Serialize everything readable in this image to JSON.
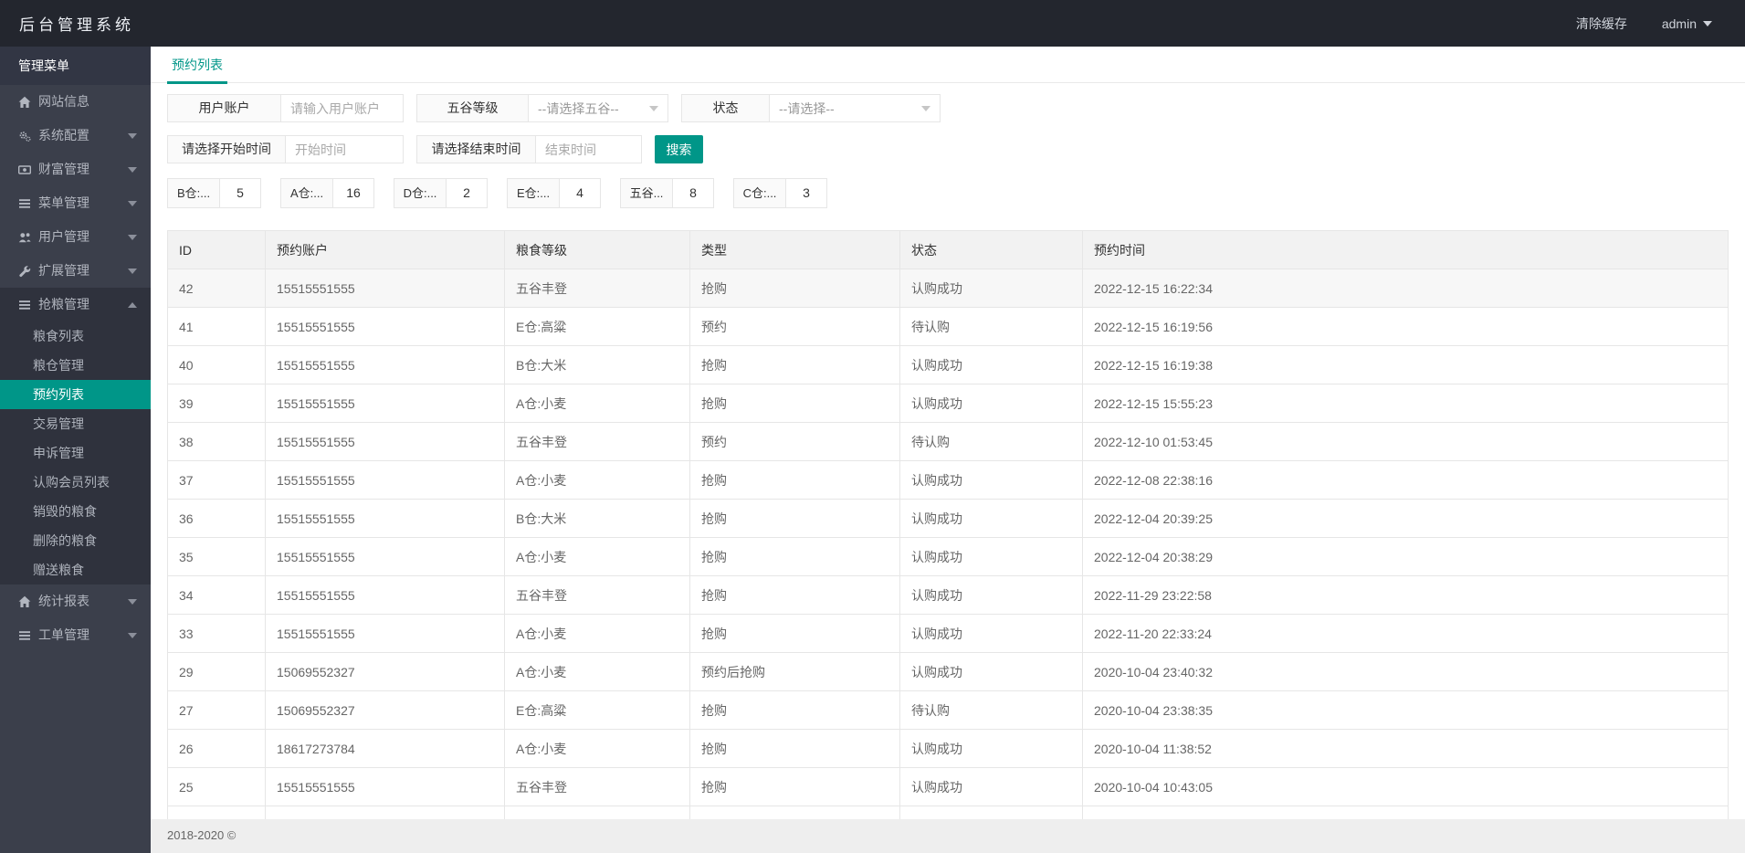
{
  "colors": {
    "accent": "#009688",
    "header_bg": "#23262e",
    "sidebar_bg": "#3b3f4b",
    "submenu_bg": "#2f323d",
    "table_header_bg": "#f2f2f2",
    "footer_bg": "#eeeeee"
  },
  "app": {
    "title": "后台管理系统"
  },
  "header": {
    "clear_cache_label": "清除缓存",
    "user_label": "admin"
  },
  "sidebar": {
    "title": "管理菜单",
    "items": [
      {
        "label": "网站信息",
        "icon": "home-icon",
        "has_children": false,
        "expanded": false,
        "children": []
      },
      {
        "label": "系统配置",
        "icon": "cogs-icon",
        "has_children": true,
        "expanded": false,
        "children": []
      },
      {
        "label": "财富管理",
        "icon": "money-icon",
        "has_children": true,
        "expanded": false,
        "children": []
      },
      {
        "label": "菜单管理",
        "icon": "list-icon",
        "has_children": true,
        "expanded": false,
        "children": []
      },
      {
        "label": "用户管理",
        "icon": "users-icon",
        "has_children": true,
        "expanded": false,
        "children": []
      },
      {
        "label": "扩展管理",
        "icon": "wrench-icon",
        "has_children": true,
        "expanded": false,
        "children": []
      },
      {
        "label": "抢粮管理",
        "icon": "list-icon",
        "has_children": true,
        "expanded": true,
        "children": [
          "粮食列表",
          "粮仓管理",
          "预约列表",
          "交易管理",
          "申诉管理",
          "认购会员列表",
          "销毁的粮食",
          "删除的粮食",
          "赠送粮食"
        ],
        "active_child": "预约列表"
      },
      {
        "label": "统计报表",
        "icon": "home-icon",
        "has_children": true,
        "expanded": false,
        "children": []
      },
      {
        "label": "工单管理",
        "icon": "list-icon",
        "has_children": true,
        "expanded": false,
        "children": []
      }
    ]
  },
  "tab": {
    "label": "预约列表"
  },
  "filters": {
    "rows": [
      {
        "fields": [
          {
            "name": "user-account",
            "label": "用户账户",
            "type": "text",
            "placeholder": "请输入用户账户"
          },
          {
            "name": "grain-level",
            "label": "五谷等级",
            "type": "select",
            "placeholder": "--请选择五谷--"
          },
          {
            "name": "status",
            "label": "状态",
            "type": "select",
            "placeholder": "--请选择--"
          }
        ]
      },
      {
        "fields": [
          {
            "name": "start-time",
            "label": "请选择开始时间",
            "type": "text",
            "placeholder": "开始时间"
          },
          {
            "name": "end-time",
            "label": "请选择结束时间",
            "type": "text",
            "placeholder": "结束时间"
          }
        ],
        "search_button": "搜索"
      }
    ]
  },
  "stats": [
    {
      "label": "B仓:...",
      "value": "5"
    },
    {
      "label": "A仓:...",
      "value": "16"
    },
    {
      "label": "D仓:...",
      "value": "2"
    },
    {
      "label": "E仓:...",
      "value": "4"
    },
    {
      "label": "五谷...",
      "value": "8"
    },
    {
      "label": "C仓:...",
      "value": "3"
    }
  ],
  "table": {
    "columns": [
      "ID",
      "预约账户",
      "粮食等级",
      "类型",
      "状态",
      "预约时间"
    ],
    "rows": [
      [
        "42",
        "15515551555",
        "五谷丰登",
        "抢购",
        "认购成功",
        "2022-12-15 16:22:34"
      ],
      [
        "41",
        "15515551555",
        "E仓:高粱",
        "预约",
        "待认购",
        "2022-12-15 16:19:56"
      ],
      [
        "40",
        "15515551555",
        "B仓:大米",
        "抢购",
        "认购成功",
        "2022-12-15 16:19:38"
      ],
      [
        "39",
        "15515551555",
        "A仓:小麦",
        "抢购",
        "认购成功",
        "2022-12-15 15:55:23"
      ],
      [
        "38",
        "15515551555",
        "五谷丰登",
        "预约",
        "待认购",
        "2022-12-10 01:53:45"
      ],
      [
        "37",
        "15515551555",
        "A仓:小麦",
        "抢购",
        "认购成功",
        "2022-12-08 22:38:16"
      ],
      [
        "36",
        "15515551555",
        "B仓:大米",
        "抢购",
        "认购成功",
        "2022-12-04 20:39:25"
      ],
      [
        "35",
        "15515551555",
        "A仓:小麦",
        "抢购",
        "认购成功",
        "2022-12-04 20:38:29"
      ],
      [
        "34",
        "15515551555",
        "五谷丰登",
        "抢购",
        "认购成功",
        "2022-11-29 23:22:58"
      ],
      [
        "33",
        "15515551555",
        "A仓:小麦",
        "抢购",
        "认购成功",
        "2022-11-20 22:33:24"
      ],
      [
        "29",
        "15069552327",
        "A仓:小麦",
        "预约后抢购",
        "认购成功",
        "2020-10-04 23:40:32"
      ],
      [
        "27",
        "15069552327",
        "E仓:高粱",
        "抢购",
        "待认购",
        "2020-10-04 23:38:35"
      ],
      [
        "26",
        "18617273784",
        "A仓:小麦",
        "抢购",
        "认购成功",
        "2020-10-04 11:38:52"
      ],
      [
        "25",
        "15515551555",
        "五谷丰登",
        "抢购",
        "认购成功",
        "2020-10-04 10:43:05"
      ]
    ]
  },
  "footer": {
    "copyright": "2018-2020 ©"
  }
}
